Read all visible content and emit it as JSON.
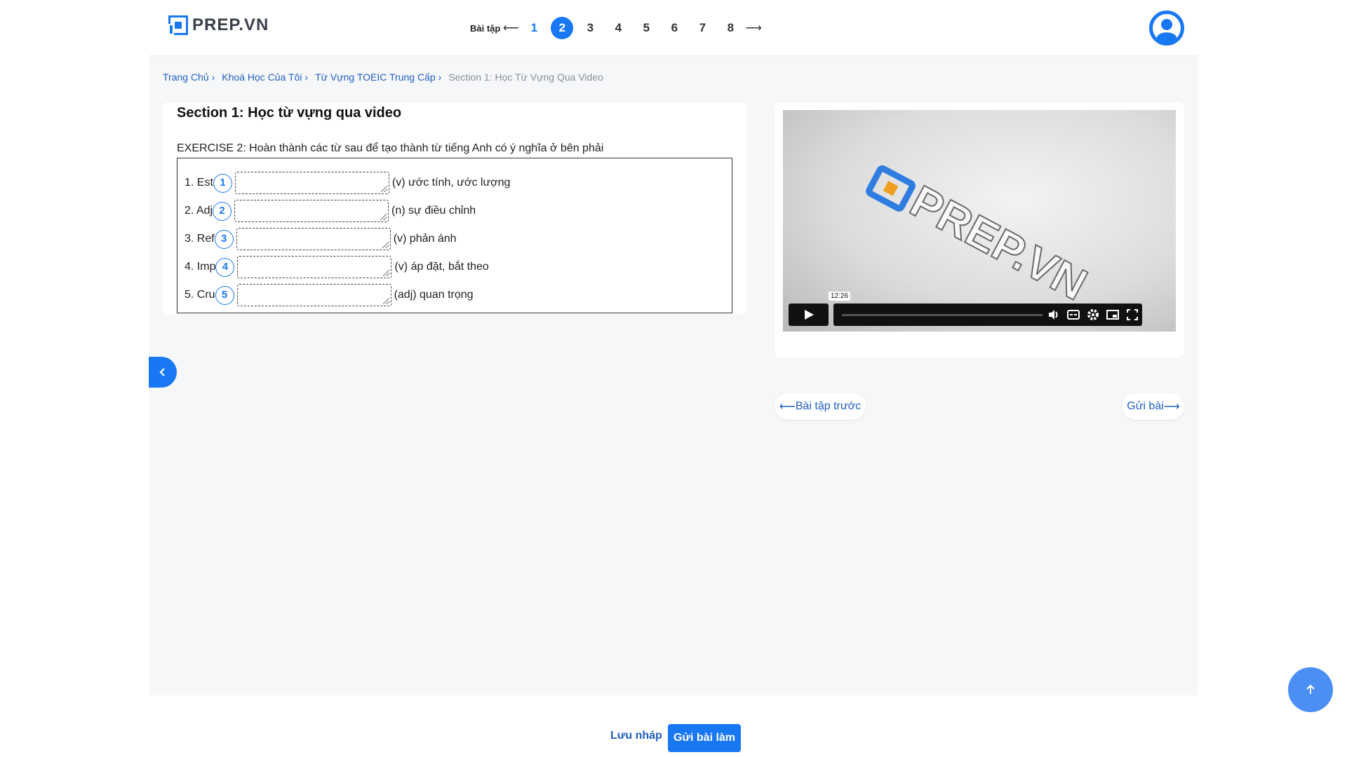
{
  "header": {
    "logo_text": "PREP.VN",
    "pager_label": "Bài tập",
    "pages": [
      "1",
      "2",
      "3",
      "4",
      "5",
      "6",
      "7",
      "8"
    ],
    "active_page": "2",
    "completed_pages": [
      "1"
    ],
    "prev_arrow": "⟵",
    "next_arrow": "⟶"
  },
  "breadcrumb": {
    "items": [
      "Trang Chủ",
      "Khoá Học Của Tôi",
      "Từ Vựng TOEIC Trung Cấp"
    ],
    "separator": "›",
    "current": "Section 1: Học Từ Vựng Qua Video"
  },
  "exercise": {
    "section_title": "Section 1: Học từ vựng qua video",
    "instruction": "EXERCISE 2: Hoàn thành các từ sau để tạo thành từ tiếng Anh có ý nghĩa ở bên phải",
    "items": [
      {
        "prefix": "1. Est",
        "number": "1",
        "meaning": "(v) ước tính, ước lượng",
        "value": ""
      },
      {
        "prefix": "2. Adj",
        "number": "2",
        "meaning": "(n) sự điều chỉnh",
        "value": ""
      },
      {
        "prefix": "3. Ref",
        "number": "3",
        "meaning": "(v) phản ánh",
        "value": ""
      },
      {
        "prefix": "4. Imp",
        "number": "4",
        "meaning": "(v) áp đặt, bắt theo",
        "value": ""
      },
      {
        "prefix": "5. Cru",
        "number": "5",
        "meaning": "(adj) quan trọng",
        "value": ""
      }
    ]
  },
  "video": {
    "watermark_text": "PREP.VN",
    "time_tooltip": "12:26",
    "icons": [
      "play-icon",
      "volume-icon",
      "captions-icon",
      "settings-icon",
      "pip-icon",
      "fullscreen-icon"
    ]
  },
  "navigation": {
    "prev_label": "Bài tập trước",
    "next_label": "Gửi bài"
  },
  "footer": {
    "save_draft_label": "Lưu nháp",
    "submit_label": "Gửi bài làm"
  },
  "colors": {
    "accent": "#1877f2",
    "link": "#1f5fbf",
    "background": "#f6f7f9"
  }
}
